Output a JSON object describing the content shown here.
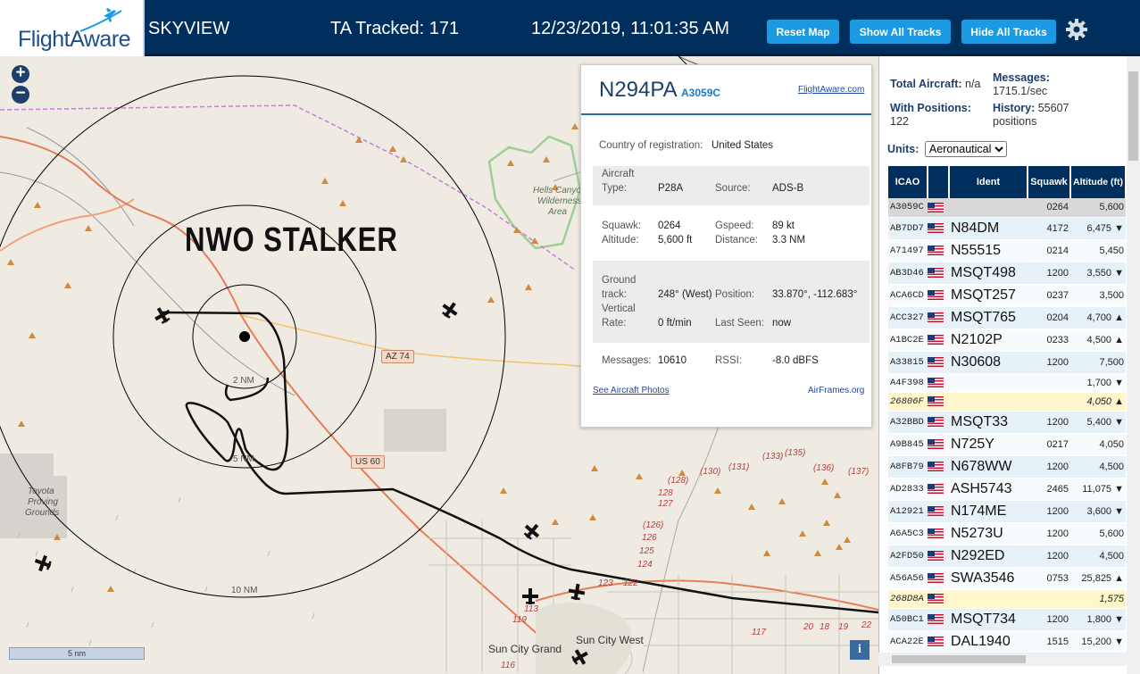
{
  "header": {
    "logo": "FlightAware",
    "app_name": "SKYVIEW",
    "tracked": "TA Tracked: 171",
    "datetime": "12/23/2019, 11:01:35 AM",
    "reset_map": "Reset Map",
    "show_all_tracks": "Show All Tracks",
    "hide_all_tracks": "Hide All Tracks"
  },
  "map": {
    "zoom_in": "+",
    "zoom_out": "−",
    "overlay_text": "NWO STALKER",
    "range_rings": [
      "2 NM",
      "5 NM",
      "10 NM"
    ],
    "scale": "5 nm",
    "info": "i",
    "labels": {
      "wilderness": [
        "Hells Canyon",
        "Wilderness",
        "Area"
      ],
      "proving": [
        "Toyota",
        "Proving",
        "Grounds"
      ],
      "sun_city_grand": "Sun City Grand",
      "sun_city_west": "Sun City West",
      "az74": "AZ 74",
      "us60": "US 60"
    },
    "route_numbers": [
      "(130)",
      "(131)",
      "(133)",
      "(135)",
      "(136)",
      "(137)",
      "(128)",
      "128",
      "127",
      "(126)",
      "126",
      "125",
      "124",
      "123",
      "122",
      "119",
      "113",
      "116",
      "117",
      "18",
      "19",
      "20",
      "22"
    ]
  },
  "popup": {
    "registration": "N294PA",
    "hex": "A3059C",
    "fa_link": "FlightAware.com",
    "country_label": "Country of registration:",
    "country": "United States",
    "aircraft_type_label": "Aircraft",
    "type_label": "Type:",
    "type": "P28A",
    "source_label": "Source:",
    "source": "ADS-B",
    "squawk_label": "Squawk:",
    "squawk": "0264",
    "altitude_label": "Altitude:",
    "altitude": "5,600 ft",
    "gspeed_label": "Gspeed:",
    "gspeed": "89 kt",
    "distance_label": "Distance:",
    "distance": "3.3 NM",
    "ground_label": "Ground",
    "track_label": "track:",
    "track": "248° (West)",
    "position_label": "Position:",
    "position": "33.870°, -112.683°",
    "vertical_label": "Vertical",
    "rate_label": "Rate:",
    "rate": "0 ft/min",
    "last_seen_label": "Last Seen:",
    "last_seen": "now",
    "messages_label": "Messages:",
    "messages": "10610",
    "rssi_label": "RSSI:",
    "rssi": "-8.0 dBFS",
    "photos_link": "See Aircraft Photos",
    "airframes_link": "AirFrames.org"
  },
  "panel": {
    "total_label": "Total Aircraft:",
    "total": "n/a",
    "messages_label": "Messages:",
    "messages": "1715.1/sec",
    "positions_label": "With Positions:",
    "positions": "122",
    "history_label": "History:",
    "history": "55607",
    "history_unit": "positions",
    "units_label": "Units:",
    "units_selected": "Aeronautical",
    "columns": [
      "ICAO",
      "",
      "Ident",
      "Squawk",
      "Altitude (ft)"
    ],
    "rows": [
      {
        "icao": "A3059C",
        "ident": "",
        "squawk": "0264",
        "alt": "5,600",
        "cls": "selected"
      },
      {
        "icao": "AB7DD7",
        "ident": "N84DM",
        "squawk": "4172",
        "alt": "6,475 ▼",
        "cls": "odd"
      },
      {
        "icao": "A71497",
        "ident": "N55515",
        "squawk": "0214",
        "alt": "5,450",
        "cls": "even"
      },
      {
        "icao": "AB3D46",
        "ident": "MSQT498",
        "squawk": "1200",
        "alt": "3,550 ▼",
        "cls": "odd"
      },
      {
        "icao": "ACA6CD",
        "ident": "MSQT257",
        "squawk": "0237",
        "alt": "3,500",
        "cls": "even"
      },
      {
        "icao": "ACC327",
        "ident": "MSQT765",
        "squawk": "0204",
        "alt": "4,700 ▲",
        "cls": "odd"
      },
      {
        "icao": "A1BC2E",
        "ident": "N2102P",
        "squawk": "0233",
        "alt": "4,500 ▲",
        "cls": "even"
      },
      {
        "icao": "A33815",
        "ident": "N30608",
        "squawk": "1200",
        "alt": "7,500",
        "cls": "odd"
      },
      {
        "icao": "A4F398",
        "ident": "",
        "squawk": "",
        "alt": "1,700 ▼",
        "cls": "even tiny"
      },
      {
        "icao": "26806F",
        "ident": "",
        "squawk": "",
        "alt": "4,050 ▲",
        "cls": "nohist"
      },
      {
        "icao": "A32BBD",
        "ident": "MSQT33",
        "squawk": "1200",
        "alt": "5,400 ▼",
        "cls": "odd"
      },
      {
        "icao": "A9B845",
        "ident": "N725Y",
        "squawk": "0217",
        "alt": "4,050",
        "cls": "even"
      },
      {
        "icao": "A8FB79",
        "ident": "N678WW",
        "squawk": "1200",
        "alt": "4,500",
        "cls": "odd"
      },
      {
        "icao": "AD2833",
        "ident": "ASH5743",
        "squawk": "2465",
        "alt": "11,075 ▼",
        "cls": "even"
      },
      {
        "icao": "A12921",
        "ident": "N174ME",
        "squawk": "1200",
        "alt": "3,600 ▼",
        "cls": "odd"
      },
      {
        "icao": "A6A5C3",
        "ident": "N5273U",
        "squawk": "1200",
        "alt": "5,600",
        "cls": "even"
      },
      {
        "icao": "A2FD50",
        "ident": "N292ED",
        "squawk": "1200",
        "alt": "4,500",
        "cls": "odd"
      },
      {
        "icao": "A56A56",
        "ident": "SWA3546",
        "squawk": "0753",
        "alt": "25,825 ▲",
        "cls": "even"
      },
      {
        "icao": "268D8A",
        "ident": "",
        "squawk": "",
        "alt": "1,575",
        "cls": "nohist"
      },
      {
        "icao": "A50BC1",
        "ident": "MSQT734",
        "squawk": "1200",
        "alt": "1,800 ▼",
        "cls": "odd"
      },
      {
        "icao": "ACA22E",
        "ident": "DAL1940",
        "squawk": "1515",
        "alt": "15,200 ▼",
        "cls": "even"
      }
    ]
  },
  "colors": {
    "header": "#002f5d",
    "button": "#1b9ae1",
    "track": "#111111",
    "boundary": "#b15bc7"
  }
}
